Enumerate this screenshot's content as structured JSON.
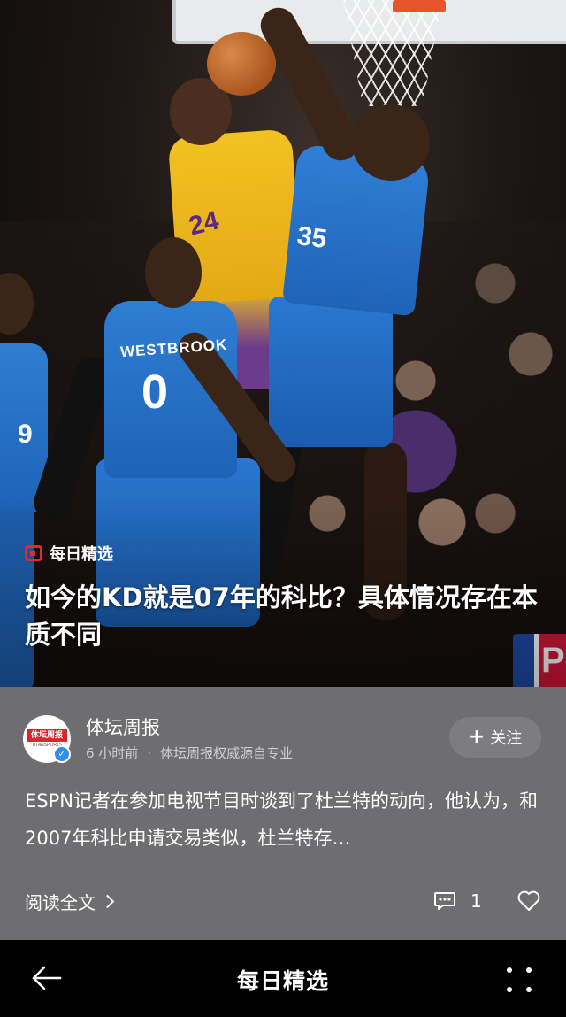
{
  "hero": {
    "jersey_name": "WESTBROOK",
    "jersey_number_front": "0",
    "jersey_number_kd": "35",
    "jersey_number_left": "9",
    "jersey_number_kobe": "24",
    "nba_letter": "P"
  },
  "badge": {
    "icon": "daily-pick-icon",
    "text": "每日精选",
    "color": "#e8262c"
  },
  "headline": "如今的KD就是07年的科比？具体情况存在本质不同",
  "author": {
    "name": "体坛周报",
    "time": "6 小时前",
    "separator": "·",
    "description": "体坛周报权威源自专业",
    "logo_text": "体坛周报",
    "logo_sub": "TITANSPORTS"
  },
  "follow_label": "关注",
  "summary": "ESPN记者在参加电视节目时谈到了杜兰特的动向，他认为，和2007年科比申请交易类似，杜兰特存…",
  "read_more": "阅读全文",
  "comment_count": "1",
  "bottom_bar": {
    "title": "每日精选"
  },
  "colors": {
    "card": "#6e6e70",
    "accent": "#e8262c",
    "verified": "#2f8cf0"
  }
}
